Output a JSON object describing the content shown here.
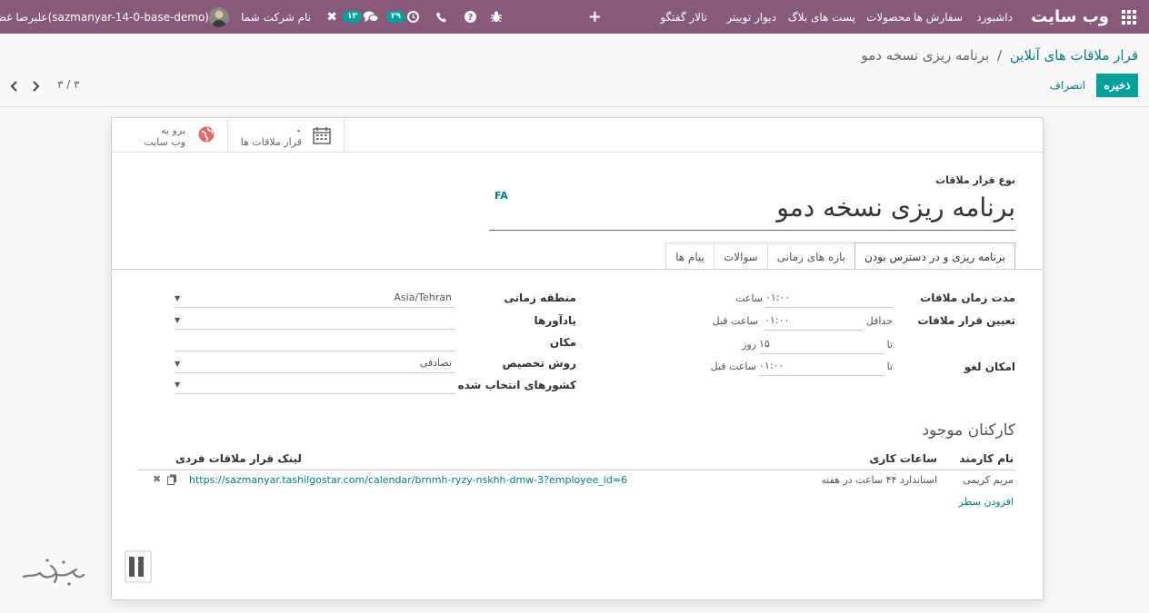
{
  "navbar": {
    "brand": "وب سایت",
    "menus": [
      "داشبورد",
      "سفارش ها",
      "محصولات",
      "پست های بلاگ",
      "دیوار توییتر",
      "تالار گفتگو"
    ],
    "activity_count": "۲۹",
    "chat_count": "۱۳",
    "company": "نام شرکت شما",
    "user": "علیرضا غضنفری",
    "db": "(sazmanyar-14-0-base-demo)"
  },
  "breadcrumb": {
    "parent": "قرار ملاقات های آنلاین",
    "separator": "/",
    "current": "برنامه ریزی نسخه دمو"
  },
  "actions": {
    "save": "ذخیره",
    "discard": "انصراف"
  },
  "pager": {
    "value": "۳ / ۳"
  },
  "buttonbox": {
    "meetings_count": "۰",
    "meetings_label": "قرار ملاقات ها",
    "website_line1": "برو به",
    "website_line2": "وب سایت"
  },
  "form": {
    "type_label": "نوع قرار ملاقات",
    "lang": "FA",
    "title": "برنامه ریزی نسخه دمو",
    "tabs": [
      "برنامه ریزی و در دسترس بودن",
      "بازه های زمانی",
      "سوالات",
      "پیام ها"
    ]
  },
  "left_group": {
    "duration_label": "مدت زمان ملاقات",
    "duration_value": "۰۱:۰۰",
    "duration_unit": "ساعت",
    "scheduling_label": "تعیین قرار ملاقات",
    "min_prefix": "حداقل",
    "min_value": "۰۱:۰۰",
    "min_unit": "ساعت قبل",
    "max_prefix": "تا",
    "max_value": "۱۵",
    "max_unit": "روز",
    "cancel_label": "امکان لغو",
    "cancel_prefix": "تا",
    "cancel_value": "۰۱:۰۰",
    "cancel_unit": "ساعت قبل"
  },
  "right_group": {
    "tz_label": "منطقه زمانی",
    "tz_value": "Asia/Tehran",
    "reminders_label": "یادآورها",
    "location_label": "مکان",
    "assign_label": "روش تخصیص",
    "assign_value": "تصادفی",
    "countries_label": "کشورهای انتخاب شده"
  },
  "employees": {
    "title": "کارکنان موجود",
    "col_name": "نام کارمند",
    "col_hours": "ساعات کاری",
    "col_link": "لینک قرار ملاقات فردی",
    "rows": [
      {
        "name": "مریم کریمی",
        "hours": "استاندارد ۴۴ ساعت در هفته",
        "link": "https://sazmanyar.tashilgostar.com/calendar/brnmh-ryzy-nskhh-dmw-3?employee_id=6"
      }
    ],
    "add_line": "افزودن سطر"
  },
  "colors": {
    "navbar": "#875a7b",
    "primary": "#00a09d",
    "link": "#017e84"
  }
}
